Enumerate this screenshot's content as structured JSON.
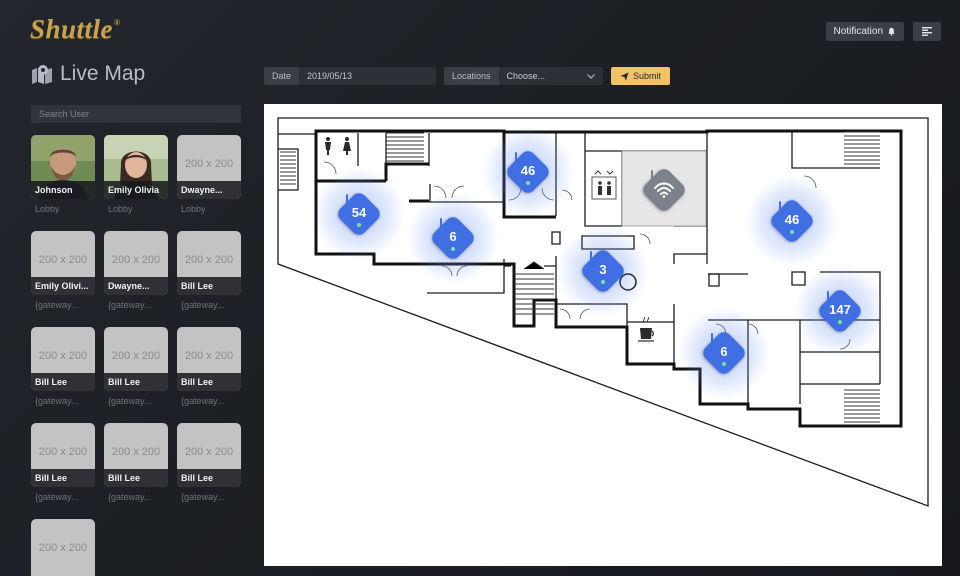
{
  "brand": {
    "name": "Shuttle",
    "reg": "®"
  },
  "header": {
    "notification_label": "Notification",
    "accent": "#c9a24d"
  },
  "page": {
    "title": "Live Map"
  },
  "search": {
    "placeholder": "Search User"
  },
  "filters": {
    "date_label": "Date",
    "date_value": "2019/05/13",
    "locations_label": "Locations",
    "locations_value": "Choose...",
    "submit_label": "Submit",
    "submit_color": "#f1c266"
  },
  "users": [
    {
      "name": "Johnson",
      "location": "Lobby",
      "photo": "photo-man"
    },
    {
      "name": "Emily Olivia",
      "location": "Lobby",
      "photo": "photo-woman"
    },
    {
      "name": "Dwayne...",
      "location": "Lobby",
      "photo": "placeholder",
      "placeholder": "200 x 200"
    },
    {
      "name": "Emily Olivi...",
      "location": "{gateway...",
      "photo": "placeholder",
      "placeholder": "200 x 200"
    },
    {
      "name": "Dwayne...",
      "location": "{gateway...",
      "photo": "placeholder",
      "placeholder": "200 x 200"
    },
    {
      "name": "Bill Lee",
      "location": "{gateway...",
      "photo": "placeholder",
      "placeholder": "200 x 200"
    },
    {
      "name": "Bill Lee",
      "location": "{gateway...",
      "photo": "placeholder",
      "placeholder": "200 x 200"
    },
    {
      "name": "Bill Lee",
      "location": "{gateway...",
      "photo": "placeholder",
      "placeholder": "200 x 200"
    },
    {
      "name": "Bill Lee",
      "location": "{gateway...",
      "photo": "placeholder",
      "placeholder": "200 x 200"
    },
    {
      "name": "Bill Lee",
      "location": "{gateway...",
      "photo": "placeholder",
      "placeholder": "200 x 200"
    },
    {
      "name": "Bill Lee",
      "location": "{gateway...",
      "photo": "placeholder",
      "placeholder": "200 x 200"
    },
    {
      "name": "Bill Lee",
      "location": "{gateway...",
      "photo": "placeholder",
      "placeholder": "200 x 200"
    },
    {
      "name": "",
      "location": "",
      "photo": "placeholder",
      "placeholder": "200 x 200"
    }
  ],
  "sensors": [
    {
      "count": "54",
      "status": "active"
    },
    {
      "count": "6",
      "status": "active"
    },
    {
      "count": "46",
      "status": "active"
    },
    {
      "count": "",
      "status": "offline",
      "icon": "wifi-icon"
    },
    {
      "count": "3",
      "status": "active"
    },
    {
      "count": "46",
      "status": "active"
    },
    {
      "count": "147",
      "status": "active"
    },
    {
      "count": "6",
      "status": "active"
    }
  ],
  "colors": {
    "sensor_active": "#3f6fe2",
    "sensor_offline": "#7b828c",
    "online_dot": "#7fe0a3"
  }
}
